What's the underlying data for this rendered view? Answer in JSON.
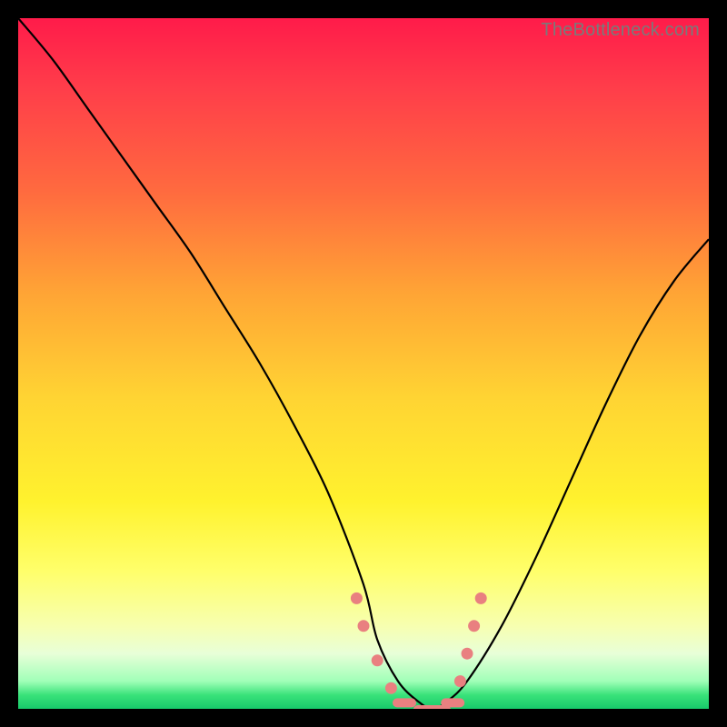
{
  "watermark": "TheBottleneck.com",
  "chart_data": {
    "type": "line",
    "title": "",
    "xlabel": "",
    "ylabel": "",
    "xlim": [
      0,
      100
    ],
    "ylim": [
      0,
      100
    ],
    "background_gradient": {
      "top": "#ff1b4a",
      "mid_upper": "#ffa535",
      "mid": "#fff22e",
      "mid_lower": "#f7ffb0",
      "bottom": "#17c96b"
    },
    "series": [
      {
        "name": "bottleneck-curve",
        "x": [
          0,
          5,
          10,
          15,
          20,
          25,
          30,
          35,
          40,
          45,
          50,
          52,
          55,
          58,
          60,
          62,
          65,
          70,
          75,
          80,
          85,
          90,
          95,
          100
        ],
        "y": [
          100,
          94,
          87,
          80,
          73,
          66,
          58,
          50,
          41,
          31,
          18,
          10,
          4,
          1,
          0,
          1,
          4,
          12,
          22,
          33,
          44,
          54,
          62,
          68
        ]
      }
    ],
    "markers": [
      {
        "x": 49,
        "y": 16,
        "kind": "dot"
      },
      {
        "x": 50,
        "y": 12,
        "kind": "dot"
      },
      {
        "x": 52,
        "y": 7,
        "kind": "dot"
      },
      {
        "x": 54,
        "y": 3,
        "kind": "dot"
      },
      {
        "x": 55,
        "y": 1,
        "kind": "bar"
      },
      {
        "x": 58,
        "y": 0,
        "kind": "bar"
      },
      {
        "x": 60,
        "y": 0,
        "kind": "bar"
      },
      {
        "x": 62,
        "y": 1,
        "kind": "bar"
      },
      {
        "x": 64,
        "y": 4,
        "kind": "dot"
      },
      {
        "x": 65,
        "y": 8,
        "kind": "dot"
      },
      {
        "x": 66,
        "y": 12,
        "kind": "dot"
      },
      {
        "x": 67,
        "y": 16,
        "kind": "dot"
      }
    ],
    "annotations": []
  }
}
